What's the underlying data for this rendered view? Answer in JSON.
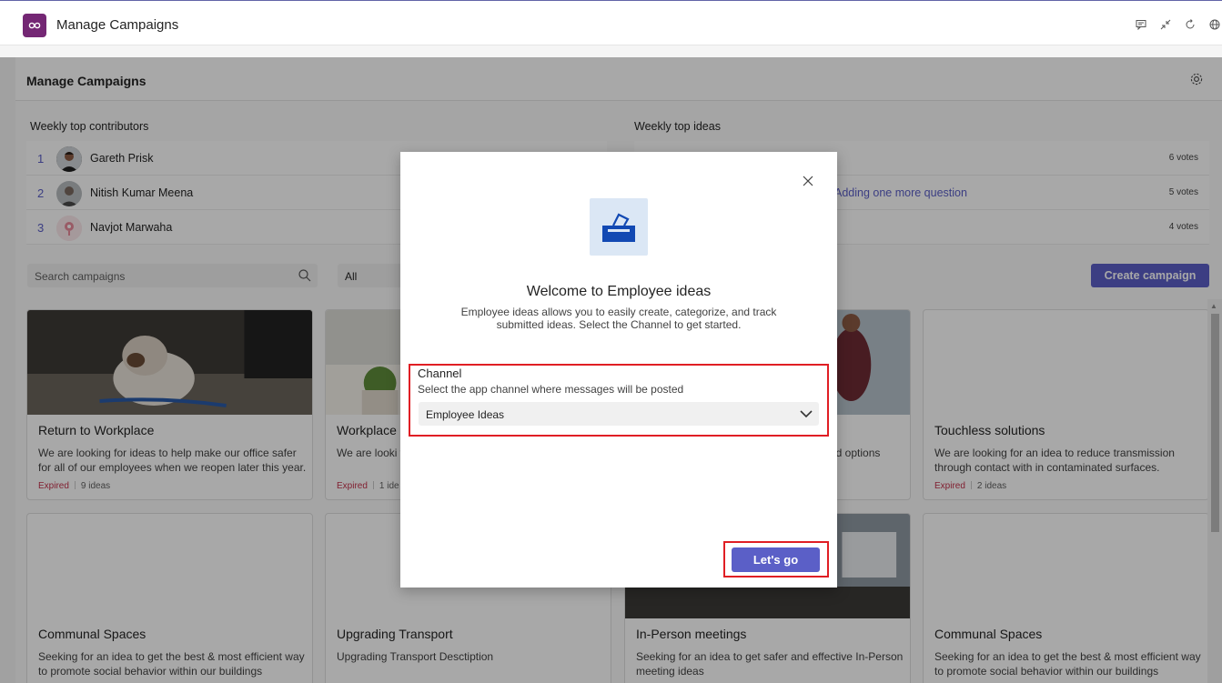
{
  "app": {
    "title": "Manage Campaigns",
    "brand_color": "#742774",
    "accent_color": "#5b5fc7",
    "top_icons": [
      "chat-icon",
      "collapse-icon",
      "refresh-icon",
      "globe-icon"
    ]
  },
  "main": {
    "title": "Manage Campaigns",
    "settings_icon": "gear-icon"
  },
  "contributors": {
    "label": "Weekly top contributors",
    "items": [
      {
        "rank": "1",
        "name": "Gareth Prisk"
      },
      {
        "rank": "2",
        "name": "Nitish Kumar Meena"
      },
      {
        "rank": "3",
        "name": "Navjot Marwaha"
      }
    ]
  },
  "top_ideas": {
    "label": "Weekly top ideas",
    "items": [
      {
        "text": "",
        "votes": "6 votes"
      },
      {
        "text": "Adding one more question",
        "votes": "5 votes"
      },
      {
        "text": "",
        "votes": "4 votes"
      }
    ]
  },
  "toolbar": {
    "search_placeholder": "Search campaigns",
    "filter_value": "All",
    "create_label": "Create campaign"
  },
  "cards": [
    {
      "title": "Return to Workplace",
      "desc": "We are looking for ideas to help make our office safer for all of our employees when we reopen later this year.",
      "status": "Expired",
      "ideas": "9 ideas"
    },
    {
      "title": "Workplace",
      "desc": "We are looki workplace",
      "status": "Expired",
      "ideas": "1 ide"
    },
    {
      "title": "",
      "desc": "od options",
      "status": "",
      "ideas": ""
    },
    {
      "title": "Touchless solutions",
      "desc": "We are looking for an idea to reduce transmission through contact with in contaminated surfaces.",
      "status": "Expired",
      "ideas": "2 ideas"
    },
    {
      "title": "Communal Spaces",
      "desc": "Seeking for an idea to get the best & most efficient way to promote social behavior within our buildings",
      "status": "",
      "ideas": ""
    },
    {
      "title": "Upgrading Transport",
      "desc": "Upgrading Transport  Desctiption",
      "status": "",
      "ideas": ""
    },
    {
      "title": "In-Person meetings",
      "desc": "Seeking for an idea to get safer and effective In-Person meeting ideas",
      "status": "",
      "ideas": ""
    },
    {
      "title": "Communal Spaces",
      "desc": "Seeking for an idea to get the best & most efficient way to promote social behavior within our buildings",
      "status": "",
      "ideas": ""
    }
  ],
  "dialog": {
    "title": "Welcome to Employee ideas",
    "description": "Employee ideas allows you to easily create, categorize, and track submitted ideas. Select the Channel to get started.",
    "channel_label": "Channel",
    "channel_help": "Select the app channel where messages will be posted",
    "channel_value": "Employee Ideas",
    "submit_label": "Let's go",
    "highlight_color": "#e01e24"
  }
}
